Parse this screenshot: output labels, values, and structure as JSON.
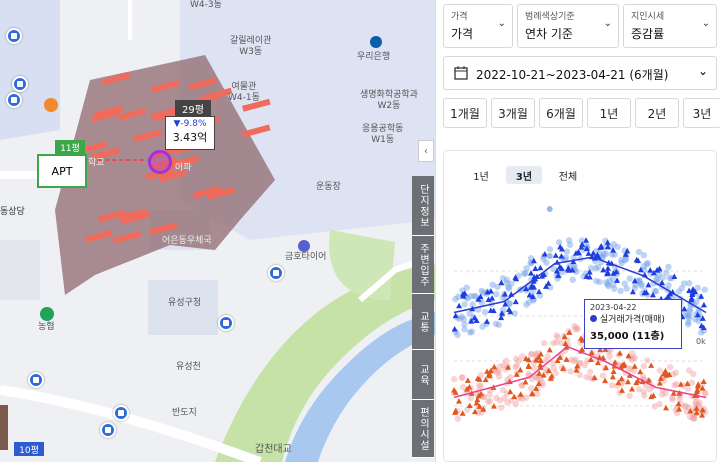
{
  "map": {
    "labels": {
      "w4_3": "W4-3동",
      "galilei": "갈릴레이관\nW3동",
      "yeomul": "여물관\nW4-1동",
      "woori_bank": "우리은행",
      "bio": "생명화학공학과\nW2동",
      "eungyong": "응용공학동\nW1동",
      "stadium": "운동장",
      "kumho": "금호타이어",
      "yuseong": "유성구청",
      "yuseongcheon": "유성천",
      "bandoji": "반도지",
      "gapcheon": "갑천대교",
      "nonghyup": "농협",
      "yeoneum": "어은동우체국",
      "dongsangdang": "동상당",
      "hwa": "아파",
      "gyo": "학교"
    },
    "unit_badge_29": "29평",
    "price_change": "▼-9.8%",
    "price_value": "3.43억",
    "unit_badge_11": "11평",
    "apt_label": "APT",
    "unit_badge_10": "10평"
  },
  "side_tabs": [
    "단지정보",
    "주변입주",
    "교통",
    "교육",
    "편의시설"
  ],
  "panel": {
    "price_select": {
      "caption": "가격",
      "value": "가격"
    },
    "color_select": {
      "caption": "범례색상기준",
      "value": "연차 기준"
    },
    "index_select": {
      "caption": "지인시세",
      "value": "증감률"
    },
    "date_range": "2022-10-21~2023-04-21 (6개월)",
    "period_buttons": [
      "1개월",
      "3개월",
      "6개월",
      "1년",
      "2년",
      "3년"
    ],
    "chart_tabs": [
      "1년",
      "3년",
      "전체"
    ],
    "active_chart_tab": "3년",
    "tooltip": {
      "date": "2023-04-22",
      "series": "실거래가격(매매)",
      "value": "35,000 (11층)"
    },
    "axis_tail": "0k"
  },
  "chart_data": {
    "type": "scatter",
    "series": [
      {
        "name": "실거래가격(매매)",
        "color": "#1f3ee0",
        "trend": [
          [
            0,
            35000
          ],
          [
            0.2,
            36200
          ],
          [
            0.4,
            40300
          ],
          [
            0.55,
            41000
          ],
          [
            0.75,
            39000
          ],
          [
            1,
            35000
          ]
        ]
      },
      {
        "color": "#e0581e",
        "trend": [
          [
            0,
            25800
          ],
          [
            0.3,
            28000
          ],
          [
            0.45,
            31300
          ],
          [
            0.6,
            29700
          ],
          [
            0.8,
            26900
          ],
          [
            1,
            25800
          ]
        ]
      }
    ],
    "highlight": {
      "date": "2023-04-22",
      "value": 35000,
      "floor": "11층"
    }
  }
}
